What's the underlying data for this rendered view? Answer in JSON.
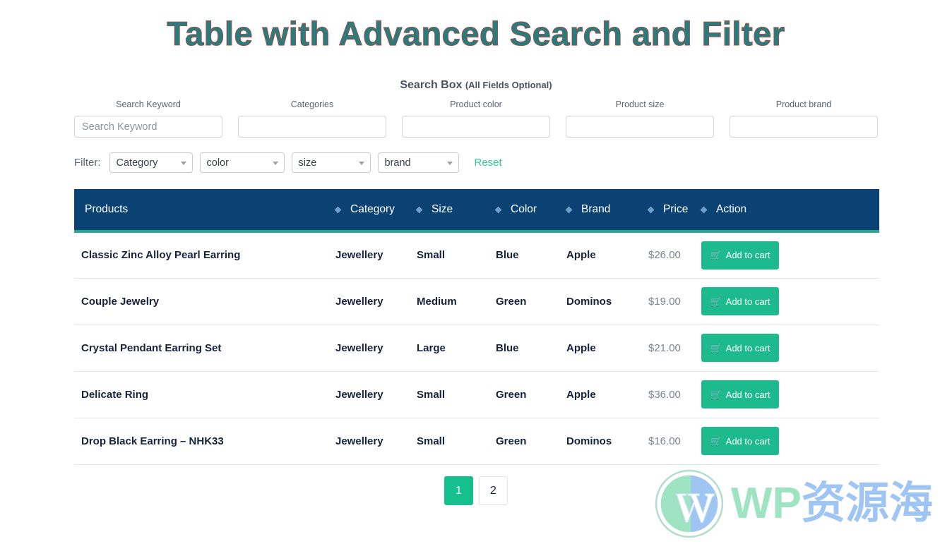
{
  "page": {
    "title": "Table with Advanced Search and Filter",
    "title_color": "#2d7a7c",
    "title_shadow_color": "#e0392b"
  },
  "search": {
    "heading_main": "Search Box ",
    "heading_sub": "(All Fields Optional)",
    "fields": [
      {
        "label": "Search Keyword",
        "placeholder": "Search Keyword",
        "value": ""
      },
      {
        "label": "Categories",
        "placeholder": "",
        "value": ""
      },
      {
        "label": "Product color",
        "placeholder": "",
        "value": ""
      },
      {
        "label": "Product size",
        "placeholder": "",
        "value": ""
      },
      {
        "label": "Product brand",
        "placeholder": "",
        "value": ""
      }
    ]
  },
  "filter": {
    "label": "Filter:",
    "selects": [
      {
        "name": "category",
        "selected": "Category"
      },
      {
        "name": "color",
        "selected": "color"
      },
      {
        "name": "size",
        "selected": "size"
      },
      {
        "name": "brand",
        "selected": "brand"
      }
    ],
    "reset_label": "Reset",
    "reset_color": "#2ecc9a"
  },
  "table": {
    "header_bg": "#0a4274",
    "header_border": "#2aa58e",
    "columns": [
      {
        "key": "products",
        "label": "Products",
        "sortable": true
      },
      {
        "key": "category",
        "label": "Category",
        "sortable": true
      },
      {
        "key": "size",
        "label": "Size",
        "sortable": true
      },
      {
        "key": "color",
        "label": "Color",
        "sortable": true
      },
      {
        "key": "brand",
        "label": "Brand",
        "sortable": true
      },
      {
        "key": "price",
        "label": "Price",
        "sortable": true
      },
      {
        "key": "action",
        "label": "Action",
        "sortable": false
      }
    ],
    "action_label": "Add to cart",
    "action_icon": "shopping-cart-icon",
    "action_color": "#1dba8d",
    "rows": [
      {
        "product": "Classic Zinc Alloy Pearl Earring",
        "category": "Jewellery",
        "size": "Small",
        "color": "Blue",
        "brand": "Apple",
        "price": "$26.00"
      },
      {
        "product": "Couple Jewelry",
        "category": "Jewellery",
        "size": "Medium",
        "color": "Green",
        "brand": "Dominos",
        "price": "$19.00"
      },
      {
        "product": "Crystal Pendant Earring Set",
        "category": "Jewellery",
        "size": "Large",
        "color": "Blue",
        "brand": "Apple",
        "price": "$21.00"
      },
      {
        "product": "Delicate Ring",
        "category": "Jewellery",
        "size": "Small",
        "color": "Green",
        "brand": "Apple",
        "price": "$36.00"
      },
      {
        "product": "Drop Black Earring – NHK33",
        "category": "Jewellery",
        "size": "Small",
        "color": "Green",
        "brand": "Dominos",
        "price": "$16.00"
      }
    ]
  },
  "pagination": {
    "pages": [
      {
        "label": "1",
        "active": true
      },
      {
        "label": "2",
        "active": false
      }
    ]
  },
  "watermark": {
    "logo_icon": "wordpress-logo-icon",
    "text_latin": "WP",
    "text_cjk": "资源海"
  }
}
